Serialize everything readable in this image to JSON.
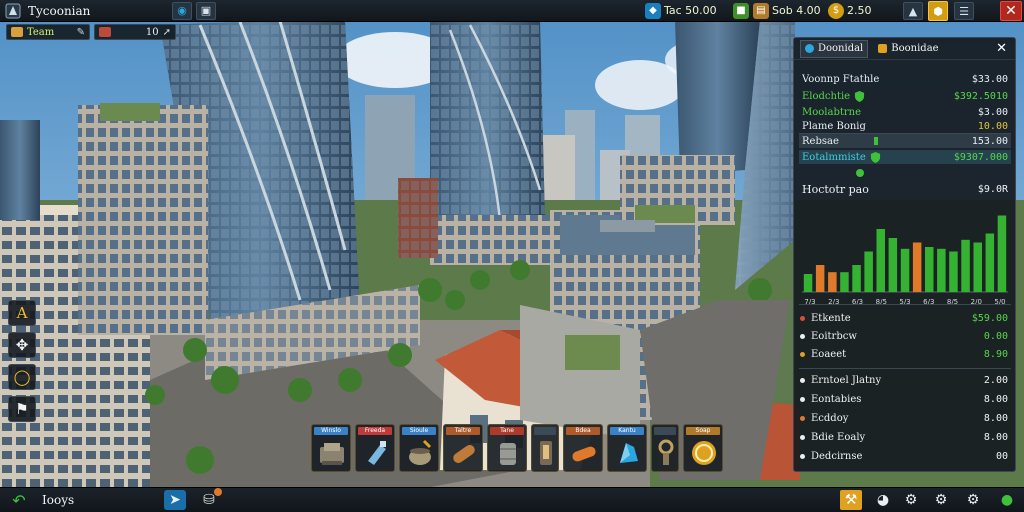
{
  "topbar": {
    "title": "Tycoonian",
    "resources": [
      {
        "icon": "gem-icon",
        "label": "Tac 50.00",
        "color": "#2aa7e0"
      },
      {
        "icon": "cube-icon",
        "label": "",
        "color": "#5ab832"
      },
      {
        "icon": "crate-icon",
        "label": "Sob 4.00",
        "color": "#d49a3a"
      },
      {
        "icon": "coin-icon",
        "label": "2.50",
        "color": "#f0b41c"
      }
    ],
    "close_label": "✕"
  },
  "chips": [
    {
      "label": "Team",
      "icon_color": "#d8a13c"
    },
    {
      "label": "10",
      "icon_color": "#c04a3a"
    }
  ],
  "panel": {
    "tab_active": "Doonidal",
    "tab_other": "Boonidae",
    "header_rows": [
      {
        "label": "Voonnp Ftathle",
        "value": "$33.00",
        "label_color": "#e8eef2",
        "value_color": "#e8eef2"
      },
      {
        "label": "Elodchtie",
        "value": "$392.5010",
        "label_color": "#56d64a",
        "value_color": "#56d64a"
      },
      {
        "label": "Moolabtrne",
        "value": "$3.00",
        "label_color": "#56d64a",
        "value_color": "#e8eef2"
      },
      {
        "label": "Plame Bonig",
        "value": "10.00",
        "label_color": "#e8eef2",
        "value_color": "#e0c23a"
      }
    ],
    "mid_rows": [
      {
        "label": "Rebsae",
        "value": "153.00",
        "label_color": "#e8eef2",
        "value_color": "#e8eef2"
      },
      {
        "label": "Eotalmmiste",
        "value": "$9307.000",
        "label_color": "#3ecfe0",
        "value_color": "#56d64a"
      }
    ],
    "chart_title": "Hoctotr pao",
    "chart_value": "$9.0R",
    "list_top": [
      {
        "label": "Etkente",
        "value": "$59.00",
        "bullet": "#e04a3a",
        "value_color": "#56d64a"
      },
      {
        "label": "Eoitrbcw",
        "value": "0.00",
        "bullet": "#e8eef2",
        "value_color": "#56d64a"
      },
      {
        "label": "Eoaeet",
        "value": "8.90",
        "bullet": "#e0a020",
        "value_color": "#56d64a"
      }
    ],
    "list_bottom": [
      {
        "label": "Erntoel Jlatny",
        "value": "2.00",
        "bullet": "#e8eef2"
      },
      {
        "label": "Eontabies",
        "value": "8.00",
        "bullet": "#e8eef2"
      },
      {
        "label": "Ecddoy",
        "value": "8.00",
        "bullet": "#e07a2a"
      },
      {
        "label": "Bdie Eoaly",
        "value": "8.00",
        "bullet": "#e8eef2"
      },
      {
        "label": "Dedcirnse",
        "value": "00",
        "bullet": "#e8eef2"
      }
    ]
  },
  "chart_data": {
    "type": "bar",
    "title": "Hoctotr pao",
    "categories": [
      "7/3",
      "2/3",
      "6/3",
      "8/5",
      "5/3",
      "6/3",
      "8/5",
      "2/0",
      "5/0"
    ],
    "values": [
      20,
      30,
      22,
      22,
      30,
      45,
      70,
      60,
      48,
      55,
      50,
      48,
      45,
      58,
      55,
      65,
      85
    ],
    "bar_colors": [
      "#35b232",
      "#e07a2a",
      "#e07a2a",
      "#35b232",
      "#35b232",
      "#35b232",
      "#35b232",
      "#35b232",
      "#35b232",
      "#e07a2a",
      "#35b232",
      "#35b232",
      "#35b232",
      "#35b232",
      "#35b232",
      "#35b232",
      "#35b232"
    ],
    "tick_labels": [
      "7/3",
      "2/3",
      "6/3",
      "8/5",
      "5/3",
      "6/3",
      "8/5",
      "2/0",
      "5/0"
    ],
    "ylim": [
      0,
      100
    ],
    "grid": false,
    "legend": "none"
  },
  "hotbar": [
    {
      "label": "Winslo",
      "label_color": "#3a82c8"
    },
    {
      "label": "Freeda",
      "label_color": "#c03a3a"
    },
    {
      "label": "Sioule",
      "label_color": "#3a82c8"
    },
    {
      "label": "Taltre",
      "label_color": "#b05a2a"
    },
    {
      "label": "Tane",
      "label_color": "#b03a2a"
    },
    {
      "label": "",
      "label_color": "#3a4a58"
    },
    {
      "label": "Bdea",
      "label_color": "#b05a2a"
    },
    {
      "label": "Kantu",
      "label_color": "#3a82c8"
    },
    {
      "label": "",
      "label_color": "#3a4a58"
    },
    {
      "label": "Soap",
      "label_color": "#b07a2a"
    }
  ],
  "bottombar": {
    "label": "Iooys"
  }
}
